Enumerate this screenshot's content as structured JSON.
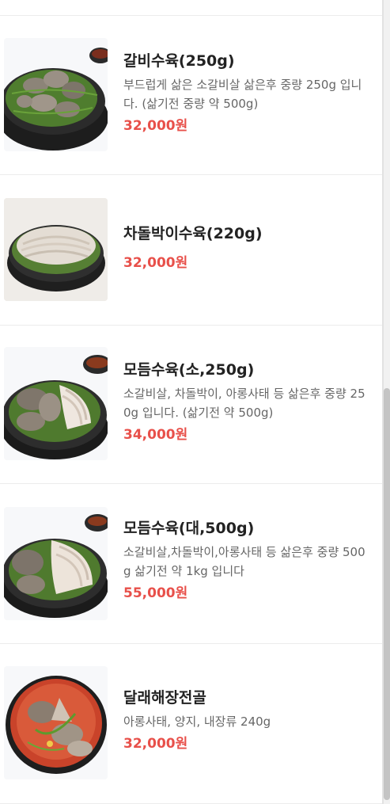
{
  "menu": {
    "items": [
      {
        "name": "갈비수육(250g)",
        "description": "부드럽게 삶은 소갈비살 삶은후 중량 250g 입니다. (삶기전 중량 약 500g)",
        "price": "32,000원",
        "image": "braised-short-rib-plate"
      },
      {
        "name": "차돌박이수육(220g)",
        "description": "",
        "price": "32,000원",
        "image": "brisket-suyuk-plate"
      },
      {
        "name": "모듬수육(소,250g)",
        "description": "소갈비살, 차돌박이, 아롱사태 등 삶은후 중량 250g 입니다. (삶기전 약 500g)",
        "price": "34,000원",
        "image": "assorted-suyuk-plate"
      },
      {
        "name": "모듬수육(대,500g)",
        "description": "소갈비살,차돌박이,아롱사태 등 삶은후 중량 500g 삶기전 약 1kg 입니다",
        "price": "55,000원",
        "image": "assorted-suyuk-large-plate"
      },
      {
        "name": "달래해장전골",
        "description": "아롱사태, 양지, 내장류 240g",
        "price": "32,000원",
        "image": "haejang-hotpot"
      }
    ]
  },
  "colors": {
    "price": "#e8504a",
    "name": "#222222",
    "description": "#666666",
    "divider": "#ececec"
  }
}
